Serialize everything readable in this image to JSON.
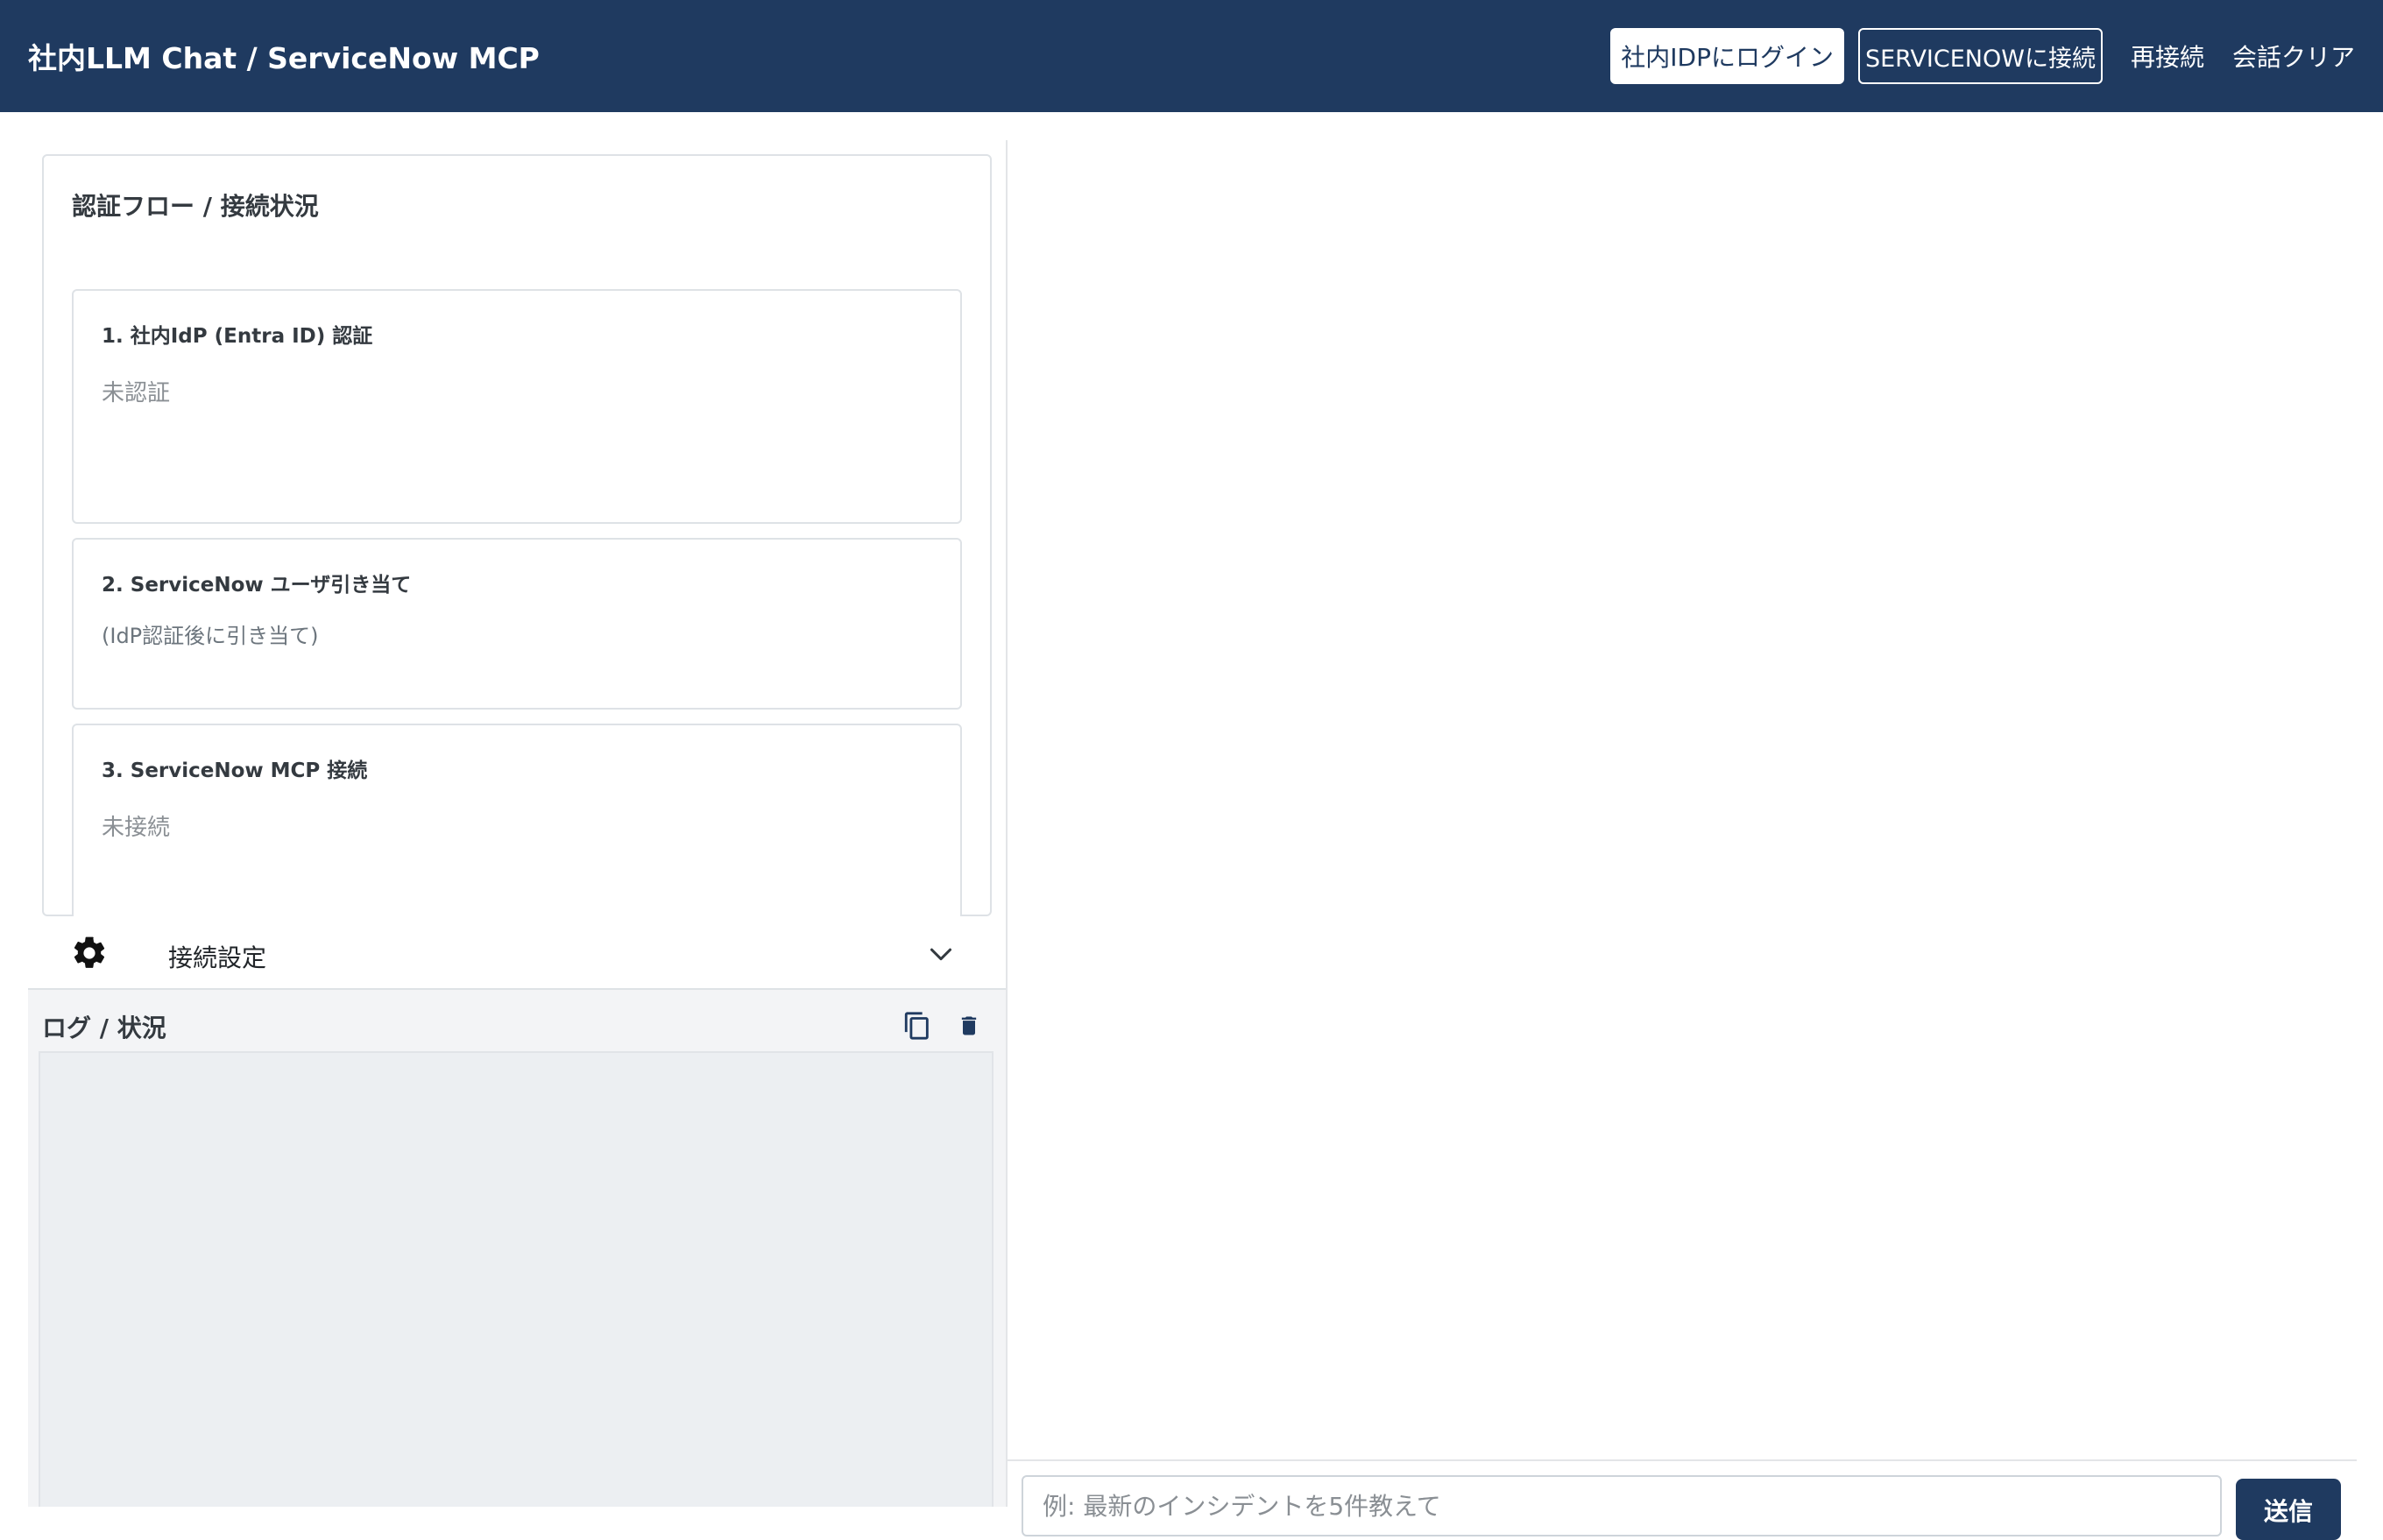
{
  "header": {
    "title": "社内LLM Chat / ServiceNow MCP",
    "buttons": {
      "idp_login": "社内IDPにログイン",
      "servicenow_connect": "SERVICENOWに接続",
      "reconnect": "再接続",
      "clear_conversation": "会話クリア"
    },
    "colors": {
      "bar": "#1f3a60"
    }
  },
  "auth_flow": {
    "title": "認証フロー / 接続状況",
    "steps": [
      {
        "title": "1. 社内IdP (Entra ID) 認証",
        "status": "未認証"
      },
      {
        "title": "2. ServiceNow ユーザ引き当て",
        "status": "(IdP認証後に引き当て)"
      },
      {
        "title": "3. ServiceNow MCP 接続",
        "status": "未接続"
      }
    ]
  },
  "settings": {
    "label": "接続設定",
    "icon": "gear-icon",
    "toggle_icon": "chevron-down-icon"
  },
  "log": {
    "title": "ログ / 状況",
    "copy_icon": "copy-icon",
    "delete_icon": "trash-icon"
  },
  "chat": {
    "input_placeholder": "例: 最新のインシデントを5件教えて",
    "send_label": "送信"
  }
}
